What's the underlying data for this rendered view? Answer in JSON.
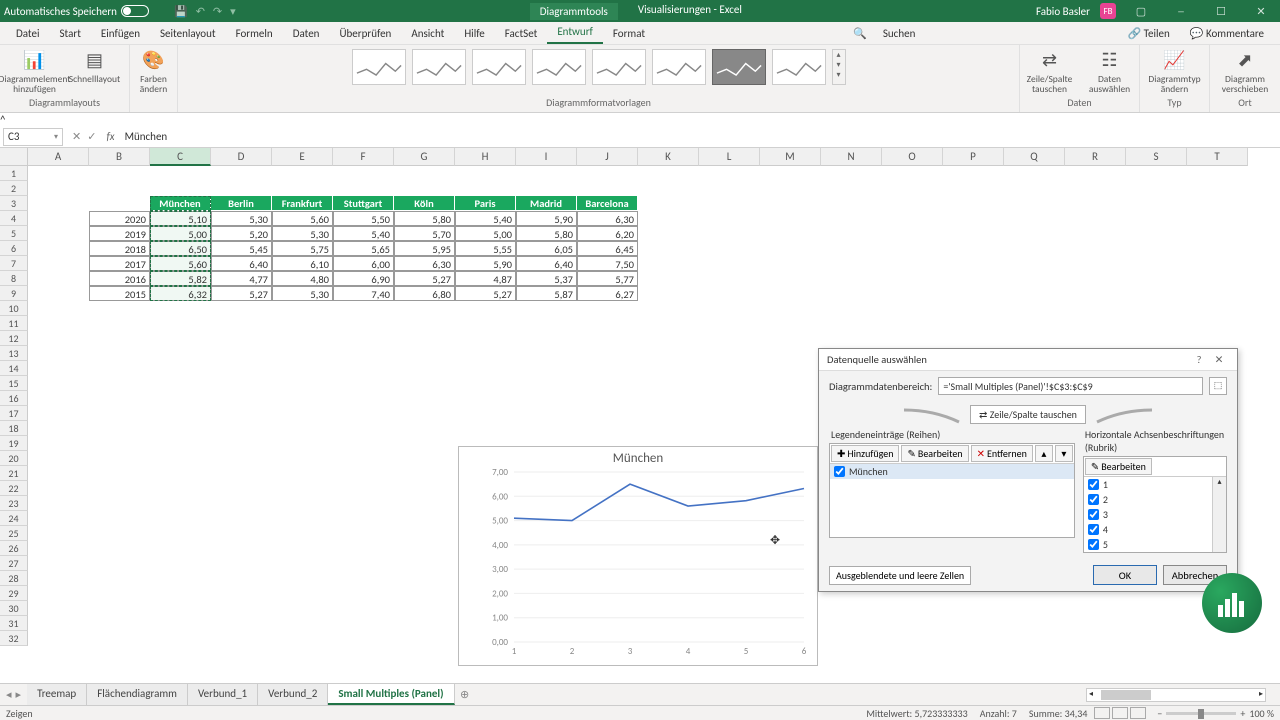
{
  "titlebar": {
    "autosave": "Automatisches Speichern",
    "tooltab": "Diagrammtools",
    "doctitle": "Visualisierungen - Excel",
    "user": "Fabio Basler",
    "initials": "FB"
  },
  "menutabs": [
    "Datei",
    "Start",
    "Einfügen",
    "Seitenlayout",
    "Formeln",
    "Daten",
    "Überprüfen",
    "Ansicht",
    "Hilfe",
    "FactSet",
    "Entwurf",
    "Format"
  ],
  "menutabs_search": "Suchen",
  "share": "Teilen",
  "comments": "Kommentare",
  "active_tab": 10,
  "ribbon": {
    "layouts_lbl": "Diagrammlayouts",
    "layouts": [
      {
        "t": "Diagrammelement hinzufügen"
      },
      {
        "t": "Schnelllayout"
      }
    ],
    "colors": "Farben ändern",
    "styles_lbl": "Diagrammformatvorlagen",
    "data_lbl": "Daten",
    "data": [
      {
        "t": "Zeile/Spalte tauschen"
      },
      {
        "t": "Daten auswählen"
      }
    ],
    "type_lbl": "Typ",
    "type": "Diagrammtyp ändern",
    "loc_lbl": "Ort",
    "loc": "Diagramm verschieben"
  },
  "namebox": "C3",
  "formula": "München",
  "columns": [
    "A",
    "B",
    "C",
    "D",
    "E",
    "F",
    "G",
    "H",
    "I",
    "J",
    "K",
    "L",
    "M",
    "N",
    "O",
    "P",
    "Q",
    "R",
    "S",
    "T"
  ],
  "row_count": 32,
  "table": {
    "headers": [
      "München",
      "Berlin",
      "Frankfurt",
      "Stuttgart",
      "Köln",
      "Paris",
      "Madrid",
      "Barcelona"
    ],
    "years": [
      2020,
      2019,
      2018,
      2017,
      2016,
      2015
    ],
    "data": [
      [
        "5,10",
        "5,30",
        "5,60",
        "5,50",
        "5,80",
        "5,40",
        "5,90",
        "6,30"
      ],
      [
        "5,00",
        "5,20",
        "5,30",
        "5,40",
        "5,70",
        "5,00",
        "5,80",
        "6,20"
      ],
      [
        "6,50",
        "5,45",
        "5,75",
        "5,65",
        "5,95",
        "5,55",
        "6,05",
        "6,45"
      ],
      [
        "5,60",
        "6,40",
        "6,10",
        "6,00",
        "6,30",
        "5,90",
        "6,40",
        "7,50"
      ],
      [
        "5,82",
        "4,77",
        "4,80",
        "6,90",
        "5,27",
        "4,87",
        "5,37",
        "5,77"
      ],
      [
        "6,32",
        "5,27",
        "5,30",
        "7,40",
        "6,80",
        "5,27",
        "5,87",
        "6,27"
      ]
    ]
  },
  "chart_data": {
    "type": "line",
    "title": "München",
    "x": [
      1,
      2,
      3,
      4,
      5,
      6
    ],
    "y": [
      5.1,
      5.0,
      6.5,
      5.6,
      5.82,
      6.32
    ],
    "ylim": [
      0,
      7
    ],
    "yticks": [
      "0,00",
      "1,00",
      "2,00",
      "3,00",
      "4,00",
      "5,00",
      "6,00",
      "7,00"
    ],
    "xlabel": "",
    "ylabel": ""
  },
  "dialog": {
    "title": "Datenquelle auswählen",
    "range_lbl": "Diagrammdatenbereich:",
    "range_val": "='Small Multiples (Panel)'!$C$3:$C$9",
    "switch": "Zeile/Spalte tauschen",
    "legend_hdr": "Legendeneinträge (Reihen)",
    "legend_btns": [
      "Hinzufügen",
      "Bearbeiten",
      "Entfernen"
    ],
    "legend_items": [
      "München"
    ],
    "axis_hdr": "Horizontale Achsenbeschriftungen (Rubrik)",
    "axis_btn": "Bearbeiten",
    "axis_items": [
      "1",
      "2",
      "3",
      "4",
      "5"
    ],
    "hidden": "Ausgeblendete und leere Zellen",
    "ok": "OK",
    "cancel": "Abbrechen"
  },
  "sheets": [
    "Treemap",
    "Flächendiagramm",
    "Verbund_1",
    "Verbund_2",
    "Small Multiples (Panel)"
  ],
  "active_sheet": 4,
  "status": {
    "mode": "Zeigen",
    "avg_lbl": "Mittelwert:",
    "avg": "5,723333333",
    "cnt_lbl": "Anzahl:",
    "cnt": "7",
    "sum_lbl": "Summe:",
    "sum": "34,34",
    "zoom": "100 %"
  }
}
